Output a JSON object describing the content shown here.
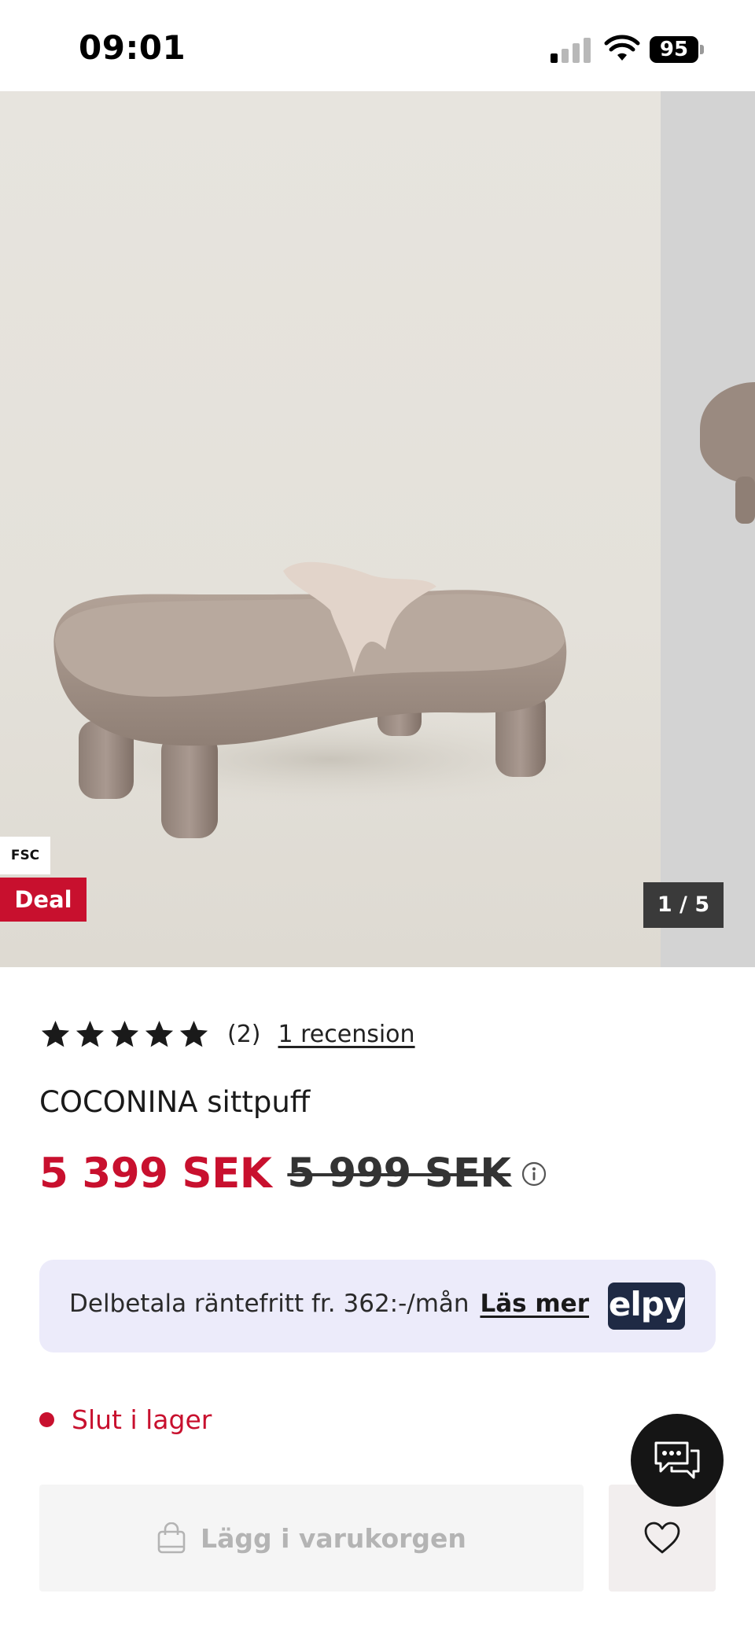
{
  "status_bar": {
    "time": "09:01",
    "battery": "95"
  },
  "gallery": {
    "badge_fsc": "FSC",
    "badge_deal": "Deal",
    "counter": "1 / 5"
  },
  "rating": {
    "stars": 5,
    "count": "(2)",
    "reviews_link": "1 recension"
  },
  "product": {
    "title": "COCONINA sittpuff",
    "price_current": "5 399 SEK",
    "price_old": "5 999 SEK"
  },
  "payment": {
    "text": "Delbetala räntefritt fr. 362:-/mån",
    "link": "Läs mer",
    "logo": "elpy"
  },
  "stock": {
    "status": "Slut i lager"
  },
  "actions": {
    "add_to_cart": "Lägg i varukorgen",
    "add_to_cart_enabled": false
  },
  "colors": {
    "accent_red": "#c8102e",
    "banner_bg": "#ecebfa",
    "elpy_navy": "#1f2a44"
  },
  "icons": {
    "cart": "shopping-bag-icon",
    "wishlist": "heart-icon",
    "chat": "chat-icon",
    "info": "info-icon",
    "star": "star-icon"
  }
}
